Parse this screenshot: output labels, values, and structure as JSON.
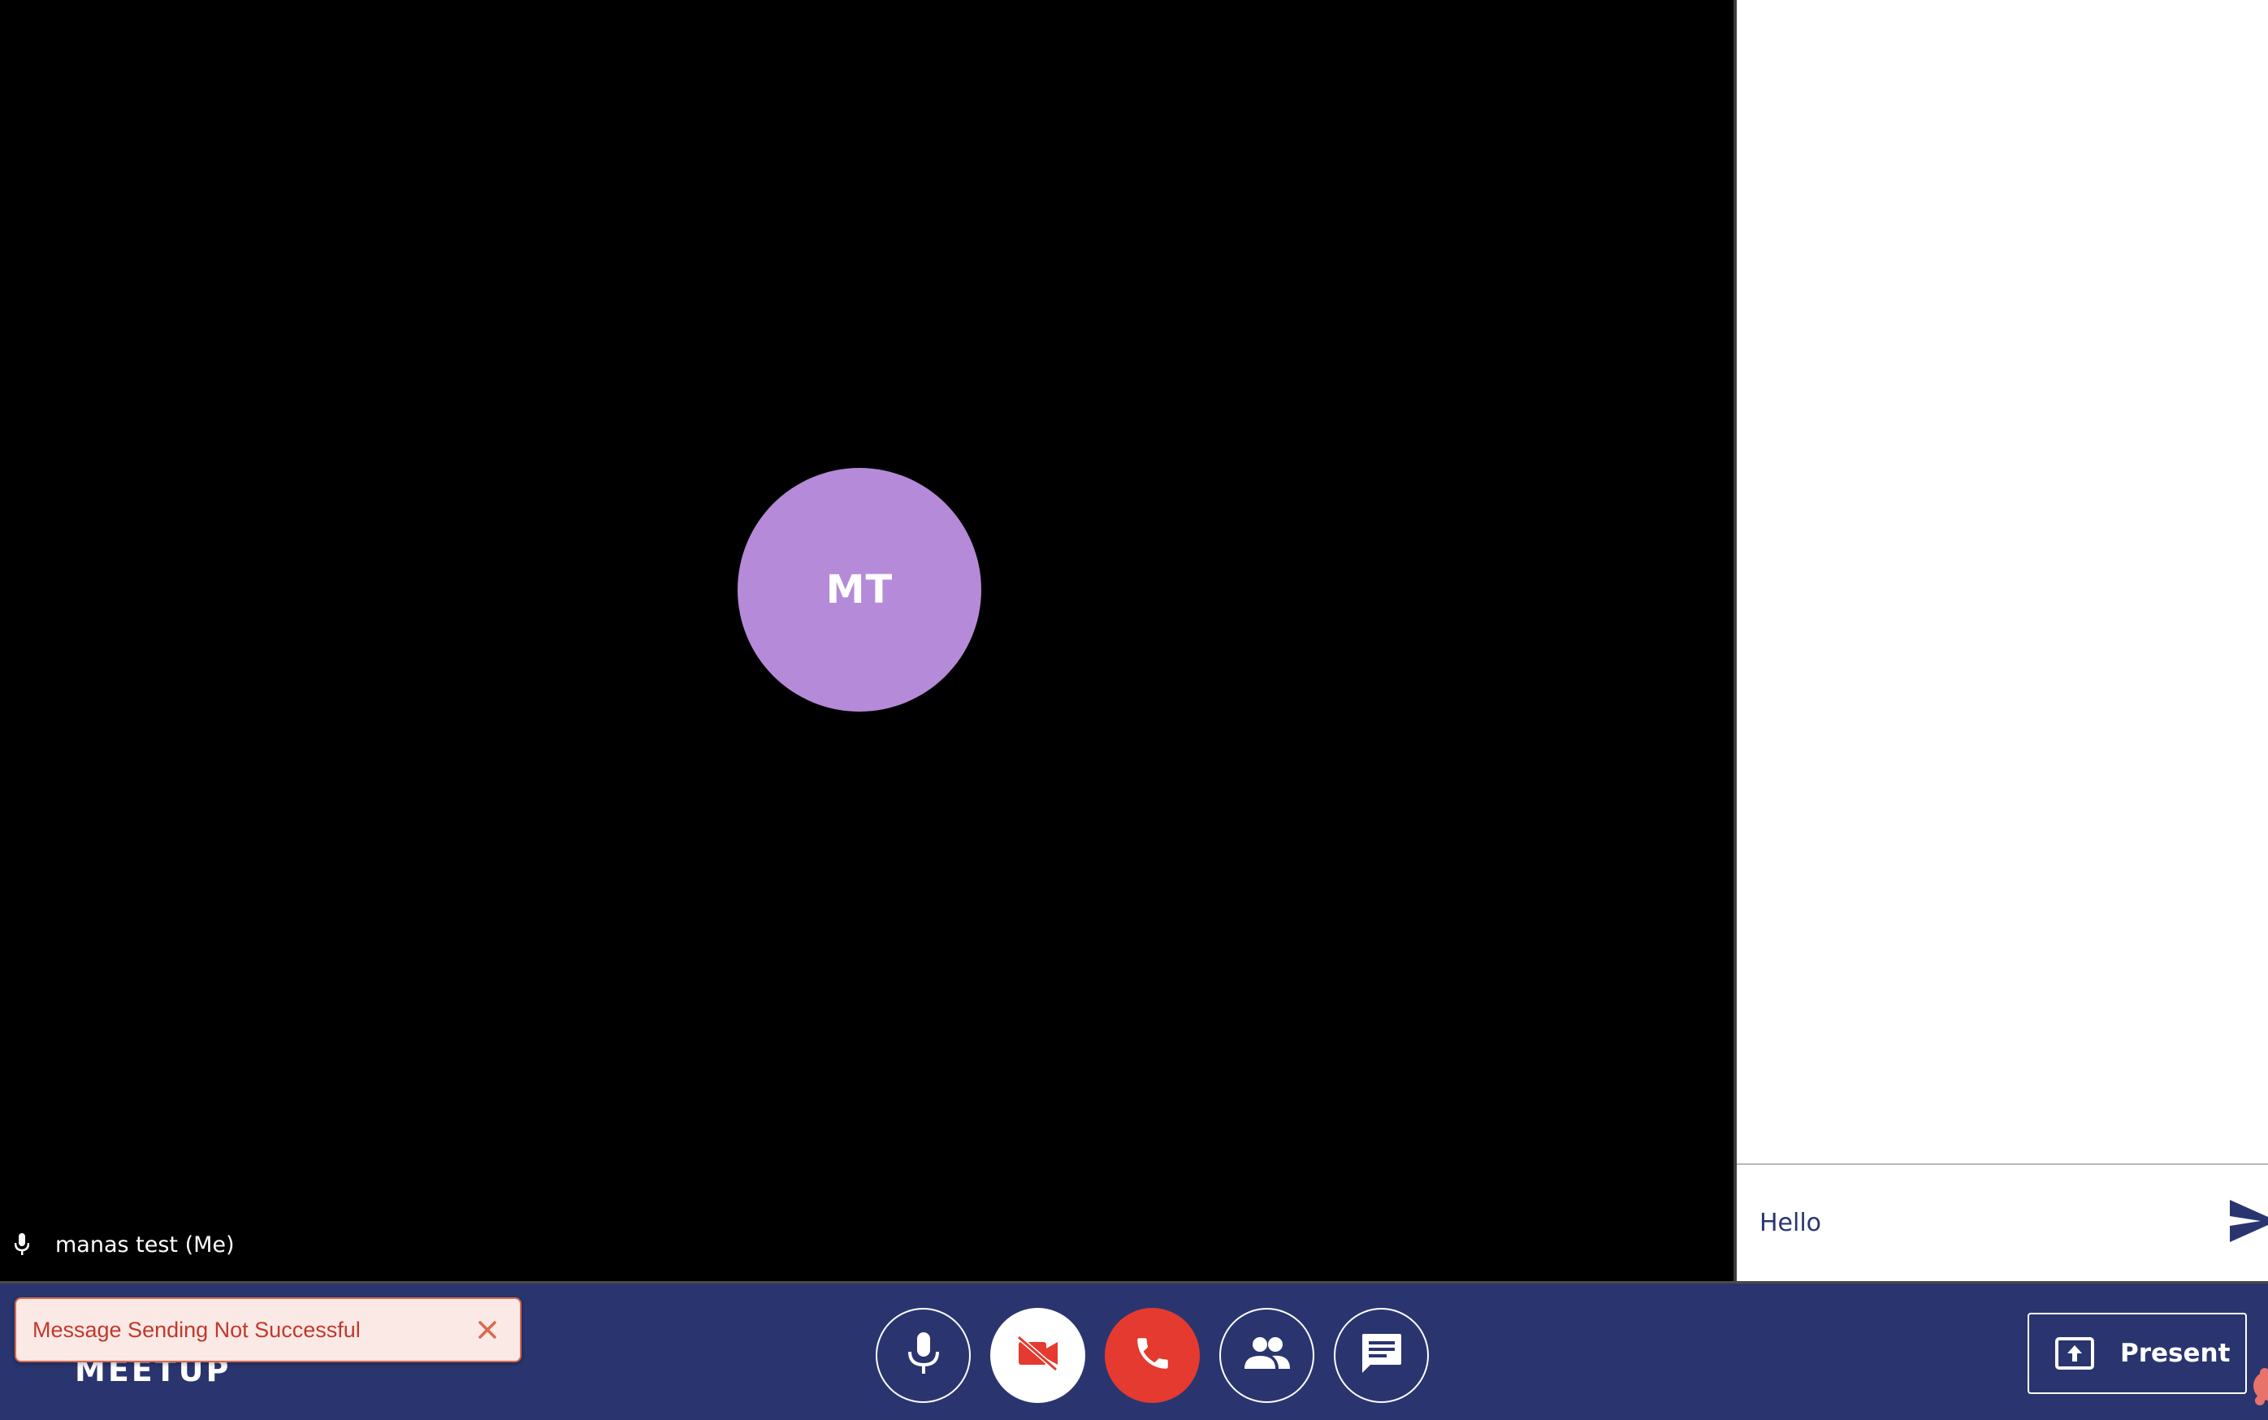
{
  "participant": {
    "initials": "MT",
    "name_label": "manas test (Me)"
  },
  "chat": {
    "input_value": "Hello"
  },
  "bottom_bar": {
    "brand": "MEETUP",
    "toast": {
      "message": "Message Sending Not Successful"
    },
    "present_label": "Present"
  },
  "icons": {
    "participant_mic": "mic-icon",
    "send": "send-icon",
    "toast_close": "close-icon",
    "mic": "mic-icon",
    "camera": "videocam-off-icon",
    "end_call": "phone-icon",
    "participants": "people-icon",
    "chat": "chat-icon",
    "present": "present-to-all-icon"
  },
  "colors": {
    "bar_background": "#2a3570",
    "avatar": "#b58ad8",
    "end_call": "#e53a2f",
    "toast_background": "#fbe9e6",
    "toast_text": "#c0392b"
  }
}
